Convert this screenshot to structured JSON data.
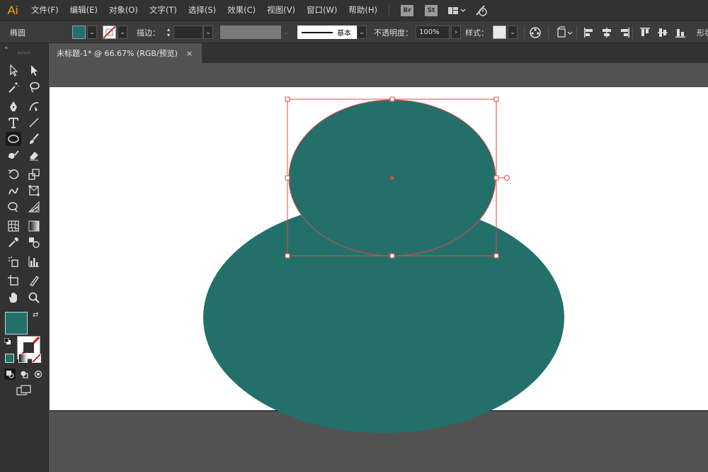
{
  "app": {
    "logo": "Ai"
  },
  "menu": {
    "items": [
      "文件(F)",
      "编辑(E)",
      "对象(O)",
      "文字(T)",
      "选择(S)",
      "效果(C)",
      "视图(V)",
      "窗口(W)",
      "帮助(H)"
    ],
    "bridge_badge": "Br",
    "stock_badge": "St"
  },
  "control_bar": {
    "shape_name": "椭圆",
    "fill_color": "#23706a",
    "stroke_label": "描边：",
    "stroke_profile_label": "基本",
    "opacity_label": "不透明度：",
    "opacity_value": "100%",
    "style_label": "样式：",
    "overflow_label": "形状"
  },
  "document": {
    "tab_title": "未标题-1* @ 66.67% (RGB/预览)",
    "close_glyph": "×"
  },
  "colors": {
    "shape_fill": "#23706a",
    "selection": "#e04a4a",
    "artboard": "#ffffff",
    "pasteboard": "#535353"
  },
  "tools": {
    "fill_swatch": "#23706a"
  }
}
